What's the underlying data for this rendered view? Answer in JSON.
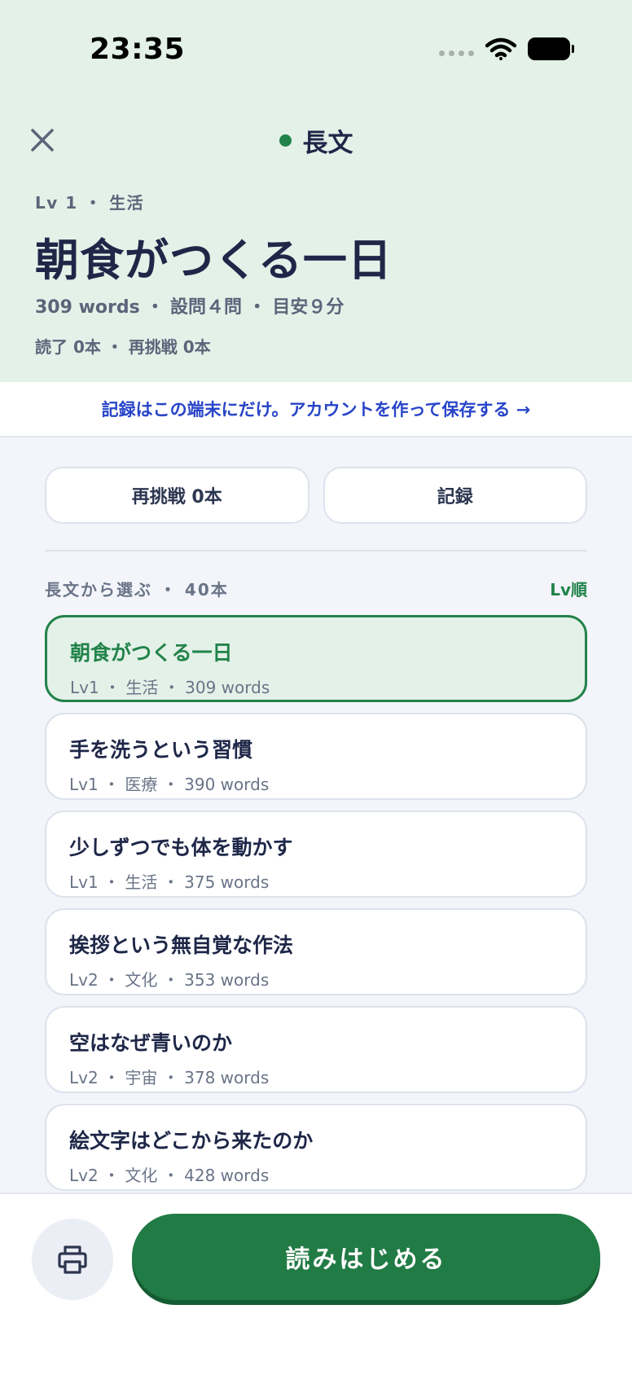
{
  "status_bar": {
    "time": "23:35"
  },
  "header": {
    "title": "長文",
    "meta_tag": "Lv 1 ・ 生活",
    "article_title": "朝食がつくる一日",
    "stats": "309 words ・ 設問４問 ・ 目安９分",
    "progress": "読了 0本 ・ 再挑戦 0本"
  },
  "banner": {
    "link_text": "記録はこの端末にだけ。アカウントを作って保存する →"
  },
  "actions": {
    "retry_label": "再挑戦 0本",
    "history_label": "記録"
  },
  "list": {
    "heading": "長文から選ぶ ・ 40本",
    "sort_label": "Lv順",
    "items": [
      {
        "title": "朝食がつくる一日",
        "meta": "Lv1 ・ 生活 ・ 309 words",
        "selected": true
      },
      {
        "title": "手を洗うという習慣",
        "meta": "Lv1 ・ 医療 ・ 390 words",
        "selected": false
      },
      {
        "title": "少しずつでも体を動かす",
        "meta": "Lv1 ・ 生活 ・ 375 words",
        "selected": false
      },
      {
        "title": "挨拶という無自覚な作法",
        "meta": "Lv2 ・ 文化 ・ 353 words",
        "selected": false
      },
      {
        "title": "空はなぜ青いのか",
        "meta": "Lv2 ・ 宇宙 ・ 378 words",
        "selected": false
      },
      {
        "title": "絵文字はどこから来たのか",
        "meta": "Lv2 ・ 文化 ・ 428 words",
        "selected": false
      }
    ]
  },
  "bottom": {
    "start_label": "読みはじめる"
  },
  "icons": {
    "close": "close-icon",
    "print": "printer-icon",
    "wifi": "wifi-icon",
    "battery": "battery-icon",
    "signal": "signal-icon"
  },
  "colors": {
    "accent_green": "#217b45",
    "header_bg": "#e3f1e8",
    "link_blue": "#2744c8",
    "title_navy": "#1e2748"
  }
}
